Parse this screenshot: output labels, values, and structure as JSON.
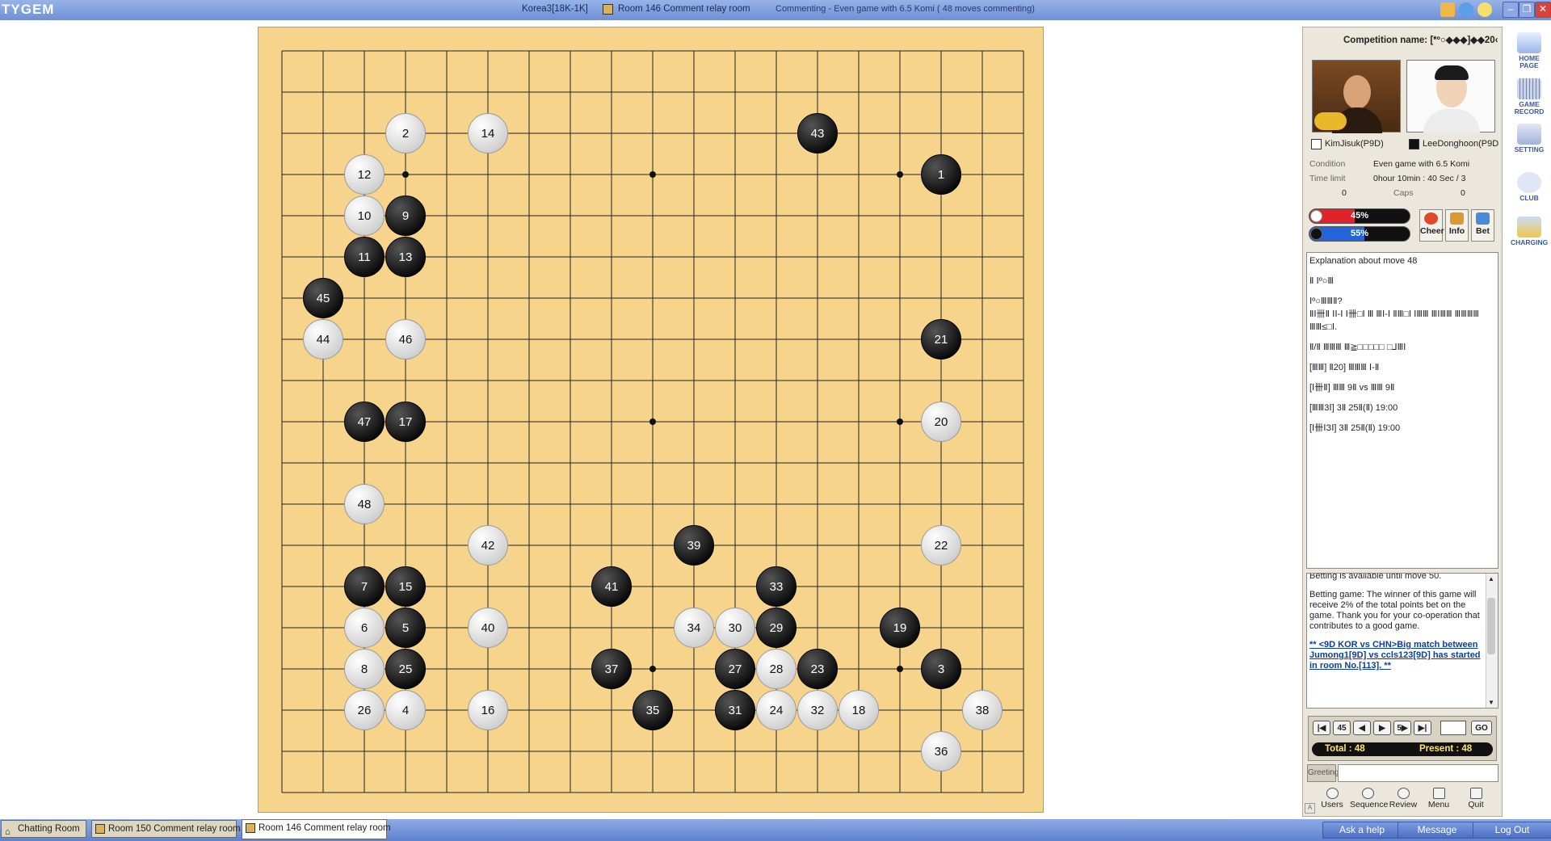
{
  "app": {
    "logo": "TYGEM",
    "user": "Korea3[18K-1K]",
    "room_title": "Room 146 Comment relay room",
    "status": "Commenting - Even game with 6.5 Komi ( 48 moves commenting)"
  },
  "panel": {
    "competition": "Competition name: [*º○◆◆◆]◆◆20‹",
    "white_player": "KimJisuk(P9D)",
    "black_player": "LeeDonghoon(P9D",
    "condition_label": "Condition",
    "condition_value": "Even game with 6.5 Komi",
    "time_label": "Time limit",
    "time_value": "0hour 10min : 40 Sec / 3",
    "caps_label": "Caps",
    "caps_white": "0",
    "caps_black": "0",
    "white_pct": "45%",
    "black_pct": "55%",
    "white_fraction": 0.45,
    "black_fraction": 0.55,
    "cheer": "Cheer",
    "info": "Info",
    "bet": "Bet"
  },
  "explanation": [
    "Explanation about move 48",
    "Ⅱ Ⅰº○Ⅲ",
    "Ⅰº○ⅢⅢⅡ?",
    "ⅡⅠ卌Ⅱ ⅠⅠ-Ⅰ Ⅰ卌□Ⅰ Ⅲ ⅢⅠ-Ⅰ ⅡⅢ□Ⅰ ⅠⅢⅢ ⅢⅠⅢⅢ ⅢⅢⅢⅢ",
    "ⅢⅢ≤□Ⅰ.",
    "Ⅱ/Ⅱ ⅢⅢⅢ Ⅲ≧□□□□□ □⅃ⅢⅠ",
    "[ⅢⅢ] Ⅱ20] ⅢⅢⅢ Ⅰ-Ⅱ",
    "[Ⅰ卌Ⅱ] ⅢⅢ 9Ⅱ vs ⅢⅢ 9Ⅱ",
    "[ⅢⅢ3Ⅰ] 3Ⅱ 25Ⅱ(Ⅱ) 19:00",
    "[Ⅰ卌ⅠЗⅠ] 3Ⅱ 25Ⅱ(Ⅱ) 19:00"
  ],
  "chat": {
    "line1": "Betting is available until move 50.",
    "line2": "Betting game: The winner of this game will receive 2% of the total points bet on the game. Thank you for your co-operation that contributes to a good game.",
    "link": "** <9D KOR vs CHN>Big match between Jumong1[9D] vs ccls123[9D] has started in room No.[113]. **"
  },
  "nav": {
    "first": "|◀",
    "back5": "45",
    "prev": "◀",
    "next": "▶",
    "fwd5": "5▶",
    "last": "▶|",
    "go": "GO",
    "total": "Total : 48",
    "present": "Present : 48"
  },
  "greeting_label": "Greeting",
  "tools": [
    "Users",
    "Sequence",
    "Review",
    "Menu",
    "Quit"
  ],
  "side_nav": [
    "HOME PAGE",
    "GAME RECORD",
    "SETTING",
    "CLUB",
    "CHARGING"
  ],
  "taskbar": {
    "tabs": [
      "Chatting Room",
      "Room 150 Comment relay room",
      "Room 146 Comment relay room"
    ],
    "ask": "Ask a help",
    "message": "Message",
    "logout": "Log Out"
  },
  "board": {
    "size": 19,
    "stones": [
      {
        "n": 1,
        "c": "b",
        "col": 16,
        "row": 3
      },
      {
        "n": 2,
        "c": "w",
        "col": 3,
        "row": 2
      },
      {
        "n": 3,
        "c": "b",
        "col": 16,
        "row": 15
      },
      {
        "n": 4,
        "c": "w",
        "col": 3,
        "row": 16
      },
      {
        "n": 5,
        "c": "b",
        "col": 3,
        "row": 14
      },
      {
        "n": 6,
        "c": "w",
        "col": 2,
        "row": 14
      },
      {
        "n": 7,
        "c": "b",
        "col": 2,
        "row": 13
      },
      {
        "n": 8,
        "c": "w",
        "col": 2,
        "row": 15
      },
      {
        "n": 9,
        "c": "b",
        "col": 3,
        "row": 4
      },
      {
        "n": 10,
        "c": "w",
        "col": 2,
        "row": 4
      },
      {
        "n": 11,
        "c": "b",
        "col": 2,
        "row": 5
      },
      {
        "n": 12,
        "c": "w",
        "col": 2,
        "row": 3
      },
      {
        "n": 13,
        "c": "b",
        "col": 3,
        "row": 5
      },
      {
        "n": 14,
        "c": "w",
        "col": 5,
        "row": 2
      },
      {
        "n": 15,
        "c": "b",
        "col": 3,
        "row": 13
      },
      {
        "n": 16,
        "c": "w",
        "col": 5,
        "row": 16
      },
      {
        "n": 17,
        "c": "b",
        "col": 3,
        "row": 9
      },
      {
        "n": 18,
        "c": "w",
        "col": 14,
        "row": 16
      },
      {
        "n": 19,
        "c": "b",
        "col": 15,
        "row": 14
      },
      {
        "n": 20,
        "c": "w",
        "col": 16,
        "row": 9
      },
      {
        "n": 21,
        "c": "b",
        "col": 16,
        "row": 7
      },
      {
        "n": 22,
        "c": "w",
        "col": 16,
        "row": 12
      },
      {
        "n": 23,
        "c": "b",
        "col": 13,
        "row": 15
      },
      {
        "n": 24,
        "c": "w",
        "col": 12,
        "row": 16
      },
      {
        "n": 25,
        "c": "b",
        "col": 3,
        "row": 15
      },
      {
        "n": 26,
        "c": "w",
        "col": 2,
        "row": 16
      },
      {
        "n": 27,
        "c": "b",
        "col": 11,
        "row": 15
      },
      {
        "n": 28,
        "c": "w",
        "col": 12,
        "row": 15
      },
      {
        "n": 29,
        "c": "b",
        "col": 12,
        "row": 14
      },
      {
        "n": 30,
        "c": "w",
        "col": 11,
        "row": 14
      },
      {
        "n": 31,
        "c": "b",
        "col": 11,
        "row": 16
      },
      {
        "n": 32,
        "c": "w",
        "col": 13,
        "row": 16
      },
      {
        "n": 33,
        "c": "b",
        "col": 12,
        "row": 13
      },
      {
        "n": 34,
        "c": "w",
        "col": 10,
        "row": 14
      },
      {
        "n": 35,
        "c": "b",
        "col": 9,
        "row": 16
      },
      {
        "n": 36,
        "c": "w",
        "col": 16,
        "row": 17
      },
      {
        "n": 37,
        "c": "b",
        "col": 8,
        "row": 15
      },
      {
        "n": 38,
        "c": "w",
        "col": 17,
        "row": 16
      },
      {
        "n": 39,
        "c": "b",
        "col": 10,
        "row": 12
      },
      {
        "n": 40,
        "c": "w",
        "col": 5,
        "row": 14
      },
      {
        "n": 41,
        "c": "b",
        "col": 8,
        "row": 13
      },
      {
        "n": 42,
        "c": "w",
        "col": 5,
        "row": 12
      },
      {
        "n": 43,
        "c": "b",
        "col": 13,
        "row": 2
      },
      {
        "n": 44,
        "c": "w",
        "col": 1,
        "row": 7
      },
      {
        "n": 45,
        "c": "b",
        "col": 1,
        "row": 6
      },
      {
        "n": 46,
        "c": "w",
        "col": 3,
        "row": 7
      },
      {
        "n": 47,
        "c": "b",
        "col": 2,
        "row": 9
      },
      {
        "n": 48,
        "c": "w",
        "col": 2,
        "row": 11
      }
    ]
  },
  "colors": {
    "board": "#f6d48b",
    "titlebar": "#7f9ce0",
    "white_bar": "#e0232b",
    "black_bar": "#2563d9"
  }
}
